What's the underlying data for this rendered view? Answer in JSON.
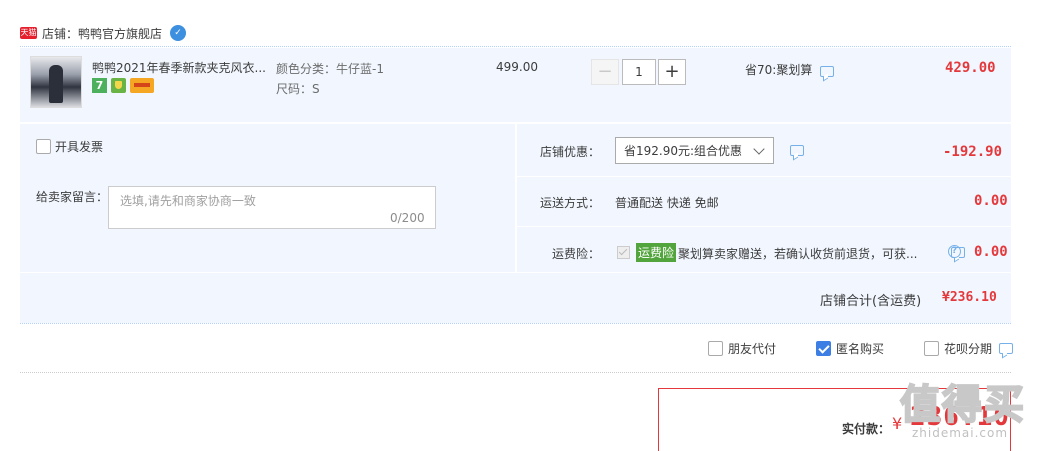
{
  "shop": {
    "badge": "天猫",
    "name": "店铺：鸭鸭官方旗舰店"
  },
  "item": {
    "title": "鸭鸭2021年春季新款夹克风衣...",
    "sku_color": "颜色分类：牛仔蓝-1",
    "sku_size": "尺码：S",
    "unit_price": "499.00",
    "qty_minus": "−",
    "qty_plus": "+",
    "quantity": "1",
    "saving": "省70:聚划算",
    "total": "429.00",
    "icon_seven": "7"
  },
  "options": {
    "invoice_label": "开具发票",
    "memo_label": "给卖家留言：",
    "memo_placeholder": "选填,请先和商家协商一致",
    "memo_count": "0/200"
  },
  "discount": {
    "label": "店铺优惠：",
    "selected": "省192.90元:组合优惠",
    "amount": "-192.90"
  },
  "shipping": {
    "label": "运送方式：",
    "value": "普通配送 快递 免邮",
    "amount": "0.00"
  },
  "insurance": {
    "label": "运费险：",
    "tag": "运费险",
    "text": "聚划算卖家赠送，若确认收货前退货，可获...",
    "help": "?",
    "amount": "0.00"
  },
  "subtotal": {
    "label": "店铺合计(含运费)",
    "amount": "¥236.10"
  },
  "pay_options": [
    {
      "label": "朋友代付",
      "checked": false
    },
    {
      "label": "匿名购买",
      "checked": true
    },
    {
      "label": "花呗分期",
      "checked": false
    }
  ],
  "payment": {
    "label": "实付款：",
    "currency": "¥",
    "amount": "236.10"
  },
  "watermark": {
    "text": "值得买",
    "url": "zhidemai.com"
  },
  "colors": {
    "accent": "#e4393c",
    "panel": "#f2f7ff",
    "link": "#3d7ee5",
    "green_tag": "#52a43c"
  }
}
